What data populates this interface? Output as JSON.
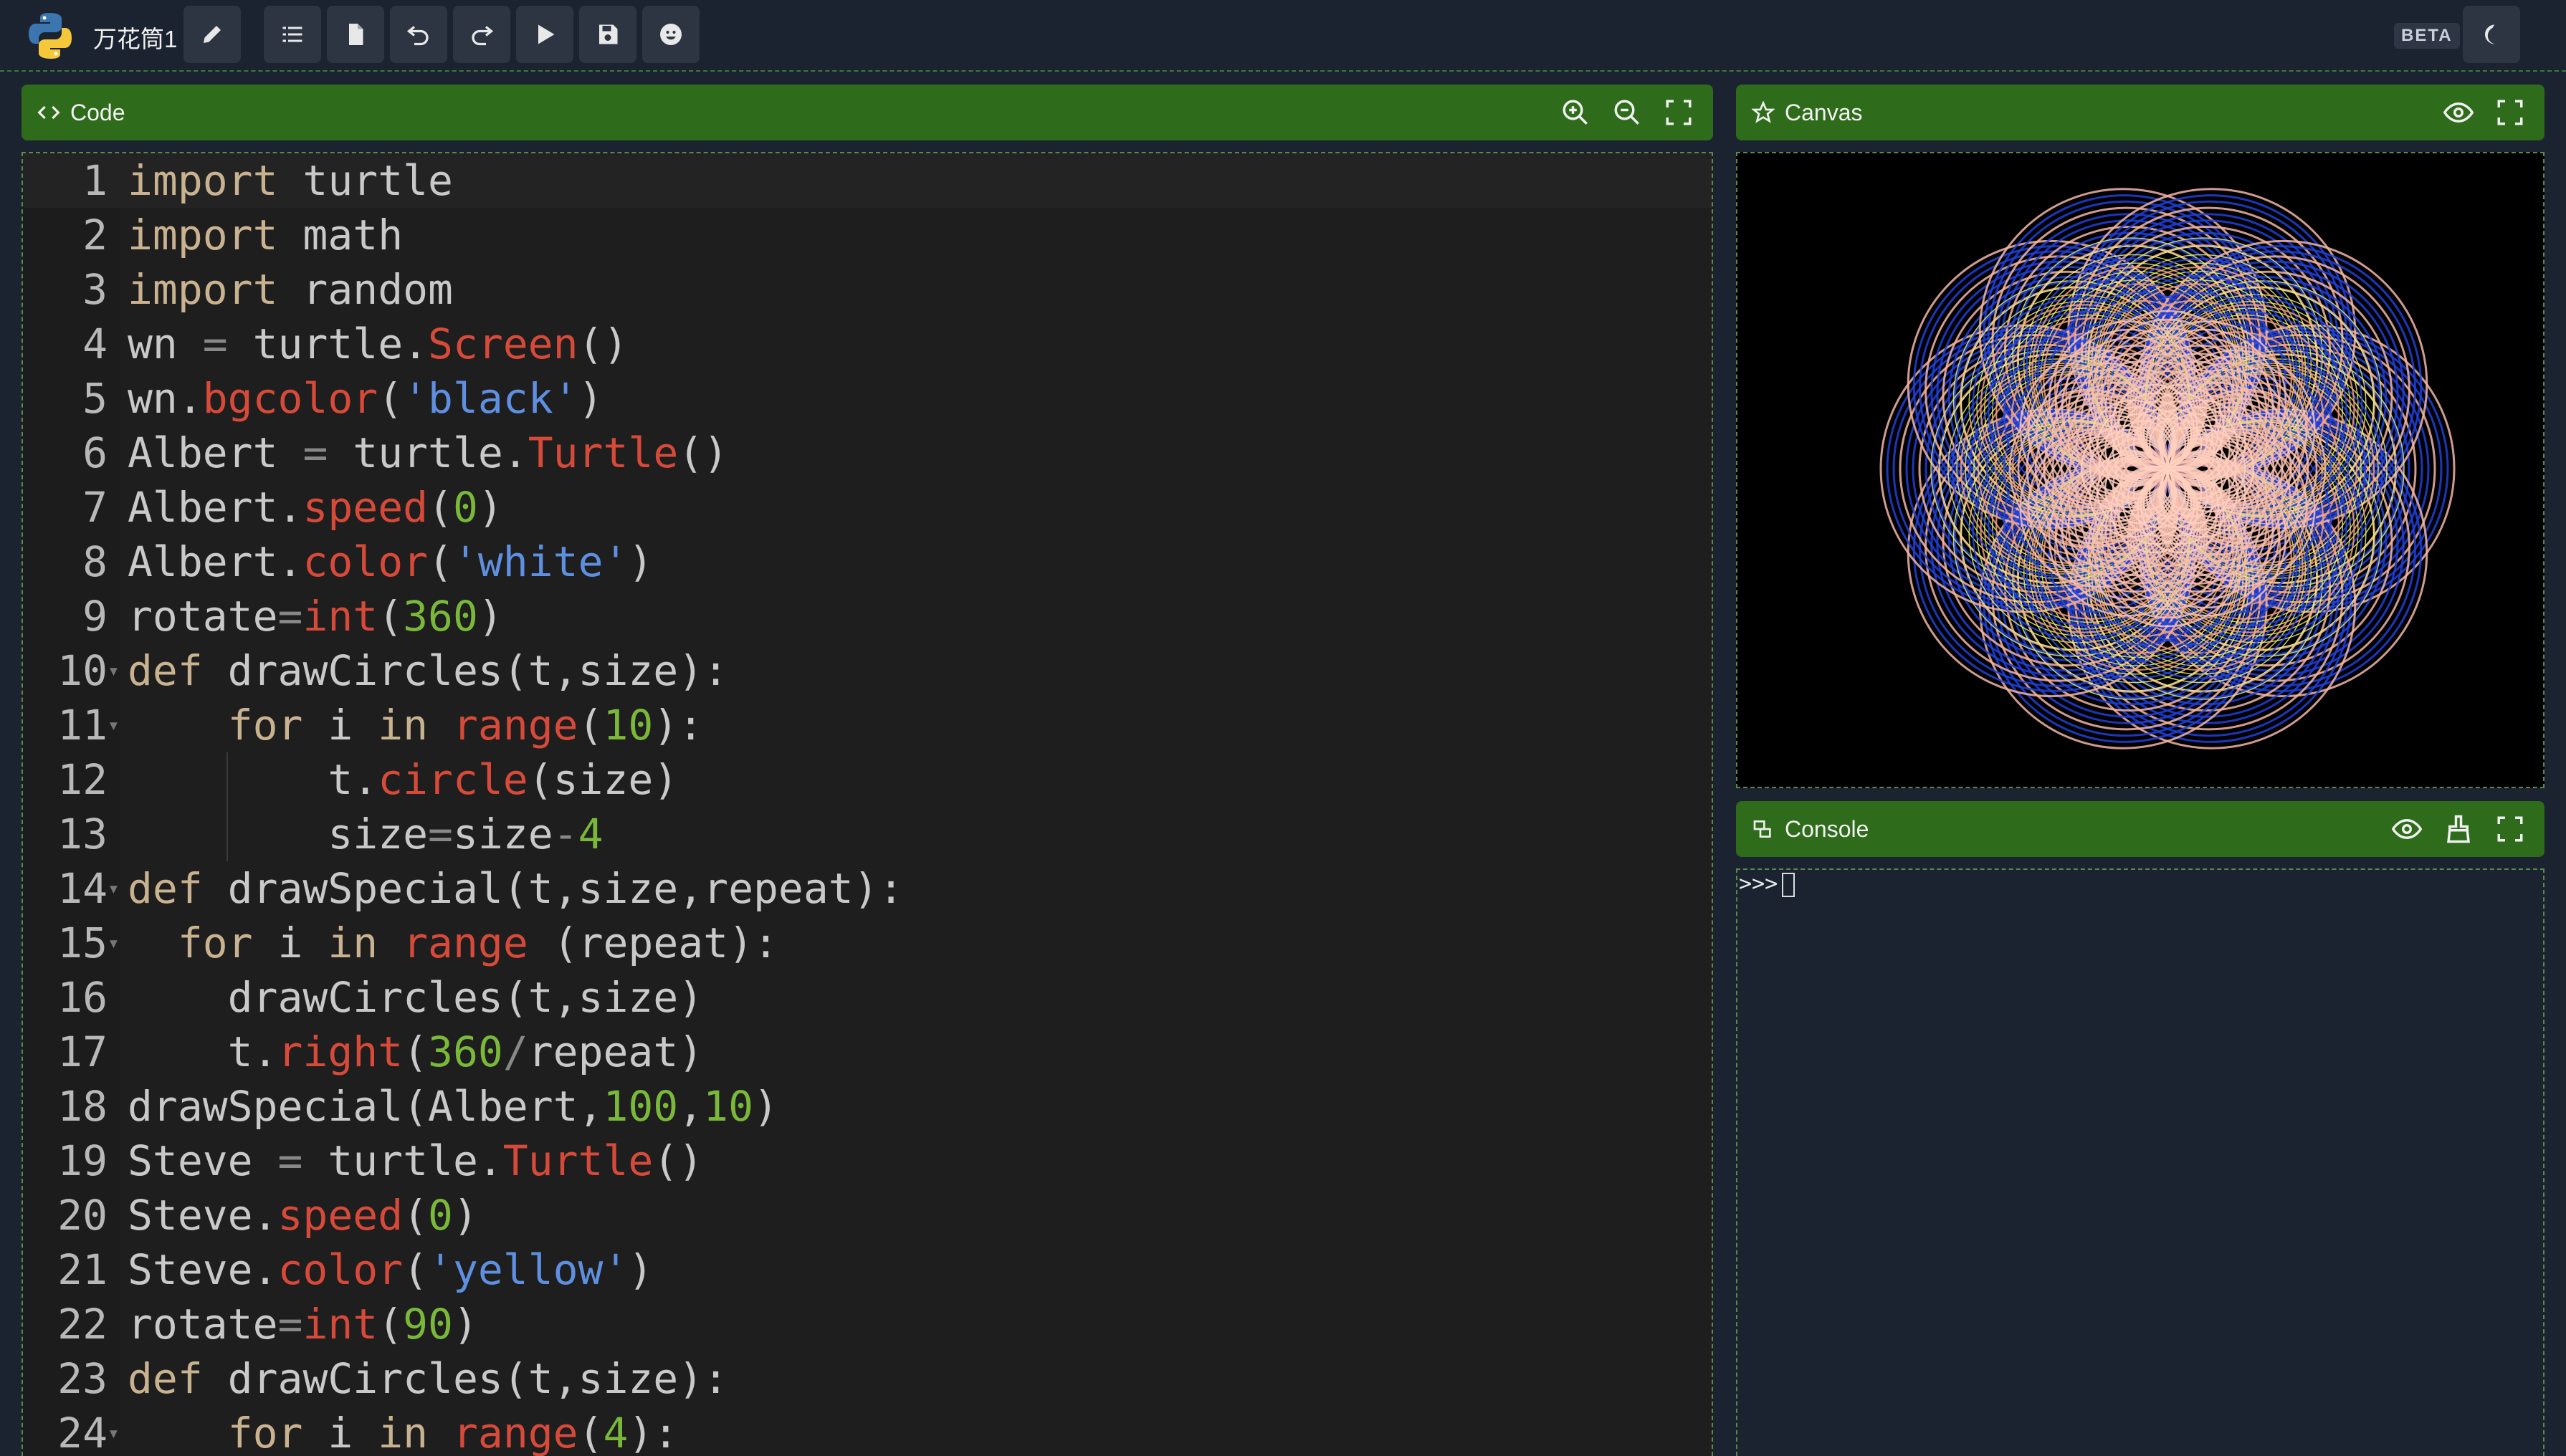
{
  "app": {
    "title": "万花筒1",
    "badge": "BETA"
  },
  "toolbar": {
    "buttons": [
      "edit-icon",
      "list-icon",
      "file-icon",
      "undo-icon",
      "redo-icon",
      "run-icon",
      "save-icon",
      "emoji-icon"
    ]
  },
  "code_panel": {
    "label": "Code"
  },
  "canvas_panel": {
    "label": "Canvas"
  },
  "console_panel": {
    "label": "Console",
    "prompt": ">>>"
  },
  "colors": {
    "panel_header": "#2e6b1a",
    "background": "#1c2330",
    "keyword": "#c9b28f",
    "function": "#d74a3a",
    "string": "#5f8fe0",
    "number": "#7ab83a"
  },
  "code_lines": [
    "import turtle",
    "import math",
    "import random",
    "wn = turtle.Screen()",
    "wn.bgcolor('black')",
    "Albert = turtle.Turtle()",
    "Albert.speed(0)",
    "Albert.color('white')",
    "rotate=int(360)",
    "def drawCircles(t,size):",
    "    for i in range(10):",
    "        t.circle(size)",
    "        size=size-4",
    "def drawSpecial(t,size,repeat):",
    "  for i in range (repeat):",
    "    drawCircles(t,size)",
    "    t.right(360/repeat)",
    "drawSpecial(Albert,100,10)",
    "Steve = turtle.Turtle()",
    "Steve.speed(0)",
    "Steve.color('yellow')",
    "rotate=int(90)",
    "def drawCircles(t,size):",
    "    for i in range(4):"
  ]
}
